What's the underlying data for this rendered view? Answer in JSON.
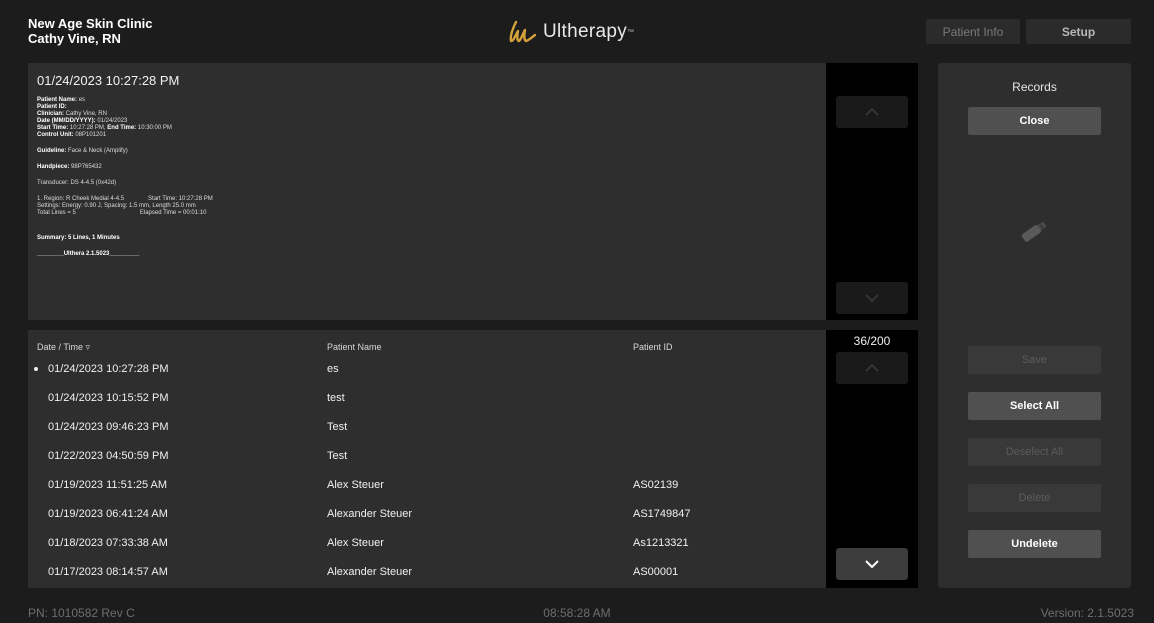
{
  "header": {
    "clinic_name": "New Age Skin Clinic",
    "clinician": "Cathy Vine, RN",
    "logo_text": "Ultherapy",
    "logo_color": "#d4a23a",
    "tabs": {
      "patient_info": "Patient Info",
      "setup": "Setup"
    }
  },
  "record": {
    "timestamp": "01/24/2023 10:27:28 PM",
    "patient_name_label": "Patient Name:",
    "patient_name": "es",
    "patient_id_label": "Patient ID:",
    "clinician_label": "Clinician:",
    "clinician": "Cathy Vine, RN",
    "date_label": "Date (MM/DD/YYYY):",
    "date": "01/24/2023",
    "start_time_label": "Start Time:",
    "start_time": "10:27:28 PM,",
    "end_time_label": "End Time:",
    "end_time": "10:30:00 PM",
    "control_unit_label": "Control Unit:",
    "control_unit": "08P101201",
    "guideline_label": "Guideline:",
    "guideline": "Face & Neck (Amplify)",
    "handpiece_label": "Handpiece:",
    "handpiece": "98P765432",
    "transducer": "Transducer: DS 4-4.5 (0x42d)",
    "region_line": "1. Region: R Cheek Medial 4-4.5",
    "region_start": "Start Time: 10:27:28 PM",
    "settings_line": "Settings: Energy: 0.90 J, Spacing: 1.5 mm, Length 25.0 mm",
    "total_lines": "Total Lines = 5",
    "elapsed": "Elapsed Time = 00:01:10",
    "summary": "Summary: 5 Lines, 1 Minutes",
    "signature": "________Ulthera 2.1.5023_________"
  },
  "list": {
    "columns": {
      "date": "Date / Time ▿",
      "name": "Patient Name",
      "id": "Patient ID"
    },
    "count": "36/200",
    "rows": [
      {
        "date": "01/24/2023 10:27:28 PM",
        "name": "es",
        "id": ""
      },
      {
        "date": "01/24/2023 10:15:52 PM",
        "name": "test",
        "id": ""
      },
      {
        "date": "01/24/2023 09:46:23 PM",
        "name": "Test",
        "id": ""
      },
      {
        "date": "01/22/2023 04:50:59 PM",
        "name": "Test",
        "id": ""
      },
      {
        "date": "01/19/2023 11:51:25 AM",
        "name": "Alex Steuer",
        "id": "AS02139"
      },
      {
        "date": "01/19/2023 06:41:24 AM",
        "name": "Alexander Steuer",
        "id": "AS1749847"
      },
      {
        "date": "01/18/2023 07:33:38 AM",
        "name": "Alex Steuer",
        "id": "As1213321"
      },
      {
        "date": "01/17/2023 08:14:57 AM",
        "name": "Alexander Steuer",
        "id": "AS00001"
      }
    ]
  },
  "records_panel": {
    "title": "Records",
    "close": "Close",
    "save": "Save",
    "select_all": "Select All",
    "deselect_all": "Deselect All",
    "delete": "Delete",
    "undelete": "Undelete"
  },
  "footer": {
    "part_number": "PN: 1010582 Rev C",
    "clock": "08:58:28 AM",
    "version": "Version: 2.1.5023"
  }
}
